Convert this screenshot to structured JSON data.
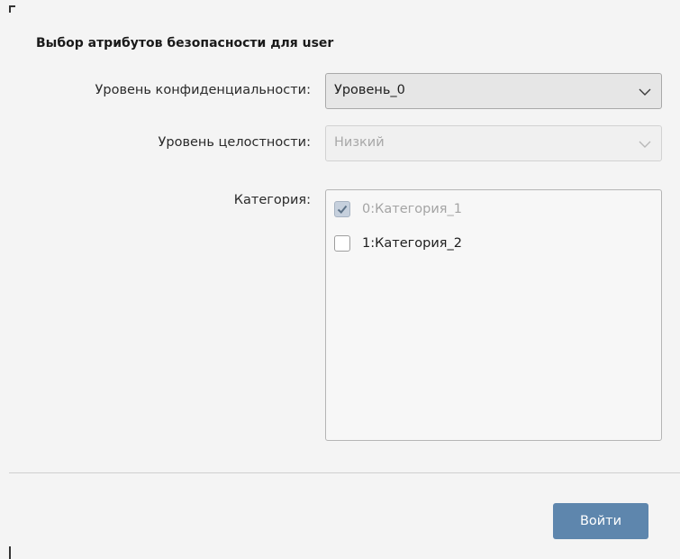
{
  "dialog": {
    "title": "Выбор атрибутов безопасности для user"
  },
  "form": {
    "confidentiality": {
      "label": "Уровень конфиденциальности:",
      "value": "Уровень_0",
      "icon": "chevron-down-icon"
    },
    "integrity": {
      "label": "Уровень целостности:",
      "value": "Низкий",
      "icon": "chevron-down-icon",
      "enabled": false
    },
    "category": {
      "label": "Категория:",
      "items": [
        {
          "label": "0:Категория_1",
          "checked": true,
          "enabled": false
        },
        {
          "label": "1:Категория_2",
          "checked": false,
          "enabled": true
        }
      ]
    }
  },
  "actions": {
    "login_label": "Войти"
  },
  "colors": {
    "primary_button": "#5e86ad",
    "background": "#f4f4f4"
  }
}
